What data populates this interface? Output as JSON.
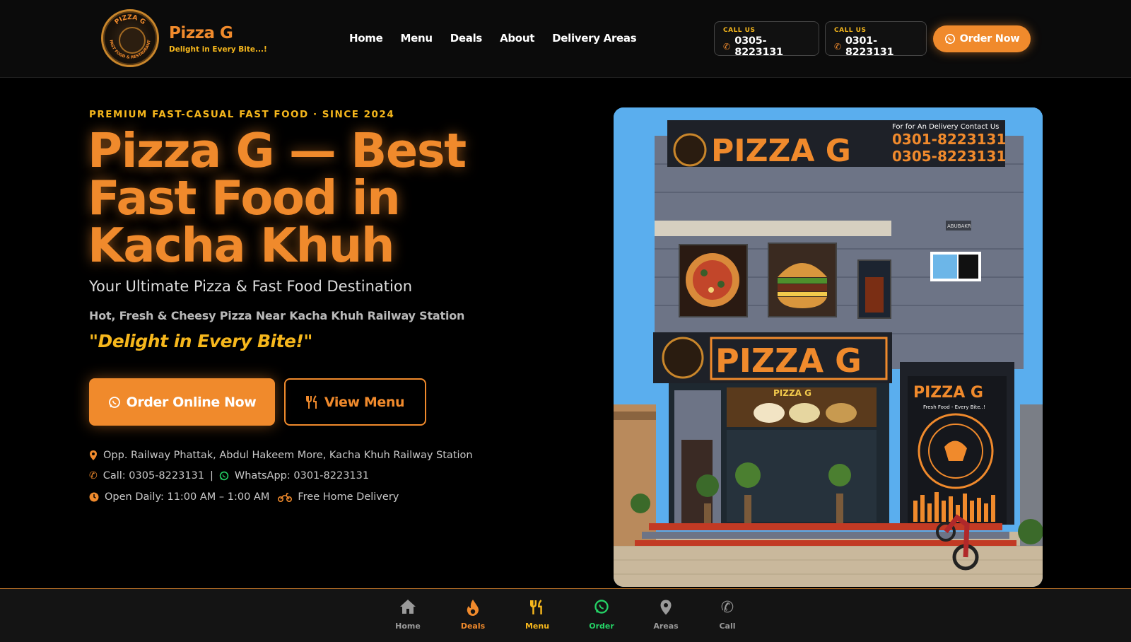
{
  "header": {
    "brand_name": "Pizza G",
    "brand_tagline": "Delight in Every Bite...!",
    "logo_text_top": "PIZZA G",
    "logo_text_ring": "FAST FOOD & RESTAURANT",
    "nav": [
      "Home",
      "Menu",
      "Deals",
      "About",
      "Delivery Areas"
    ],
    "call_boxes": [
      {
        "label": "CALL US",
        "number": "0305-8223131"
      },
      {
        "label": "CALL US",
        "number": "0301-8223131"
      }
    ],
    "order_button": "Order Now"
  },
  "hero": {
    "eyebrow": "PREMIUM FAST-CASUAL FAST FOOD · SINCE 2024",
    "title": "Pizza G — Best Fast Food in Kacha Khuh",
    "subtitle": "Your Ultimate Pizza & Fast Food Destination",
    "subtitle2": "Hot, Fresh & Cheesy Pizza Near Kacha Khuh Railway Station",
    "quote": "\"Delight in Every Bite!\"",
    "primary_button": "Order Online Now",
    "secondary_button": "View Menu",
    "address": "Opp. Railway Phattak, Abdul Hakeem More, Kacha Khuh Railway Station",
    "call_text": "Call: 0305-8223131",
    "separator": "|",
    "whatsapp_text": "WhatsApp: 0301-8223131",
    "hours_text": "Open Daily: 11:00 AM – 1:00 AM",
    "delivery_text": "Free Home Delivery"
  },
  "photo": {
    "top_sign": "PIZZA G",
    "top_sign_contact_title": "For for An Delivery Contact Us",
    "top_sign_phone1": "0301-8223131",
    "top_sign_phone2": "0305-8223131",
    "mid_sign": "PIZZA G",
    "window_sign": "PIZZA G",
    "right_panel_title": "PIZZA G",
    "right_panel_tagline": "Fresh Food - Every Bite..!",
    "right_panel_ring": "FAST FOOD & RESTAURANT",
    "small_plate": "ABUBAKR"
  },
  "bottom_nav": [
    {
      "label": "Home",
      "color": "#9a9a9a"
    },
    {
      "label": "Deals",
      "color": "#f08a2c"
    },
    {
      "label": "Menu",
      "color": "#f6b71c"
    },
    {
      "label": "Order",
      "color": "#25d366"
    },
    {
      "label": "Areas",
      "color": "#9a9a9a"
    },
    {
      "label": "Call",
      "color": "#9a9a9a"
    }
  ],
  "colors": {
    "accent_orange": "#f08a2c",
    "accent_yellow": "#f6b71c",
    "whatsapp_green": "#25d366",
    "background": "#000000"
  }
}
